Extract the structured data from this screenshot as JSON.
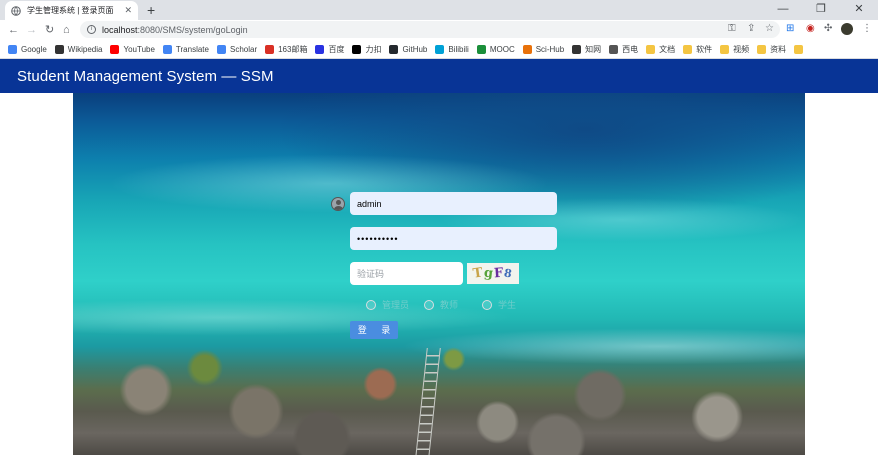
{
  "browser": {
    "tab_title": "学生管理系统 | 登录页面",
    "url_host": "localhost",
    "url_path": ":8080/SMS/system/goLogin",
    "bookmarks": [
      {
        "label": "Google",
        "icon": "google-icon",
        "color": "#4285f4"
      },
      {
        "label": "Wikipedia",
        "icon": "wikipedia-icon",
        "color": "#333333"
      },
      {
        "label": "YouTube",
        "icon": "youtube-icon",
        "color": "#ff0000"
      },
      {
        "label": "Translate",
        "icon": "translate-icon",
        "color": "#4285f4"
      },
      {
        "label": "Scholar",
        "icon": "scholar-icon",
        "color": "#4285f4"
      },
      {
        "label": "163邮箱",
        "icon": "mail-163-icon",
        "color": "#d93025"
      },
      {
        "label": "百度",
        "icon": "baidu-icon",
        "color": "#2932e1"
      },
      {
        "label": "力扣",
        "icon": "leetcode-icon",
        "color": "#000000"
      },
      {
        "label": "GitHub",
        "icon": "github-icon",
        "color": "#24292e"
      },
      {
        "label": "Bilibili",
        "icon": "bilibili-icon",
        "color": "#00a1d6"
      },
      {
        "label": "MOOC",
        "icon": "mooc-icon",
        "color": "#1b8f3a"
      },
      {
        "label": "Sci-Hub",
        "icon": "scihub-icon",
        "color": "#e8710a"
      },
      {
        "label": "知网",
        "icon": "cnki-icon",
        "color": "#333333"
      },
      {
        "label": "西电",
        "icon": "xidian-icon",
        "color": "#555555"
      },
      {
        "label": "文档",
        "icon": "folder-icon",
        "color": "#f4c542"
      },
      {
        "label": "软件",
        "icon": "folder-icon",
        "color": "#f4c542"
      },
      {
        "label": "视频",
        "icon": "folder-icon",
        "color": "#f4c542"
      },
      {
        "label": "资料",
        "icon": "folder-icon",
        "color": "#f4c542"
      },
      {
        "label": "",
        "icon": "folder-icon",
        "color": "#f4c542"
      }
    ]
  },
  "page": {
    "brand": "Student Management System — SSM",
    "navbar_color": "#083496"
  },
  "login": {
    "username_value": "admin",
    "password_value": "••••••••••",
    "vcode_placeholder": "验证码",
    "captcha_chars": [
      "T",
      "g",
      "F",
      "8"
    ],
    "roles": [
      "管理员",
      "教师",
      "学生"
    ],
    "login_label": "登 录"
  }
}
